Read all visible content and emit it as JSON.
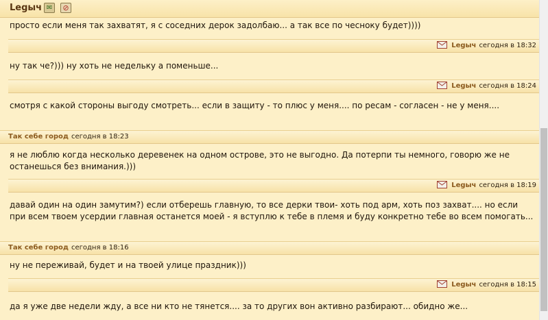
{
  "header": {
    "author": "Legыч"
  },
  "messages": [
    {
      "text": "просто если меня так захватят, я с соседних дерок задолбаю... а так все по чесноку будет))))"
    },
    {
      "author": "Legыч",
      "time": "сегодня в 18:32",
      "text": "ну так че?))) ну хоть не недельку а поменьше..."
    },
    {
      "author": "Legыч",
      "time": "сегодня в 18:24",
      "text": "смотря с какой стороны выгоду смотреть... если в защиту - то плюс у меня.... по ресам - согласен - не у меня...."
    },
    {
      "author": "Так себе город",
      "time": "сегодня в 18:23",
      "text": "я не люблю когда несколько деревенек на одном острове, это не выгодно. Да потерпи ты немного, говорю же не останешься без внимания.)))"
    },
    {
      "author": "Legыч",
      "time": "сегодня в 18:19",
      "text": "давай один на один замутим?) если отберешь главную, то все дерки твои- хоть под арм, хоть поз захват.... но если при всем твоем усердии главная останется моей - я вступлю к тебе в племя и буду конкретно тебе во всем помогать..."
    },
    {
      "author": "Так себе город",
      "time": "сегодня в 18:16",
      "text": "ну не переживай, будет и на твоей улице праздник)))"
    },
    {
      "author": "Legыч",
      "time": "сегодня в 18:15",
      "text": "да я уже две недели жду, а все ни кто не тянется.... за то других вон активно разбирают... обидно же..."
    }
  ],
  "colors": {
    "background": "#fdf0c8",
    "author": "#8b5a1e",
    "header_author": "#5a3713"
  }
}
